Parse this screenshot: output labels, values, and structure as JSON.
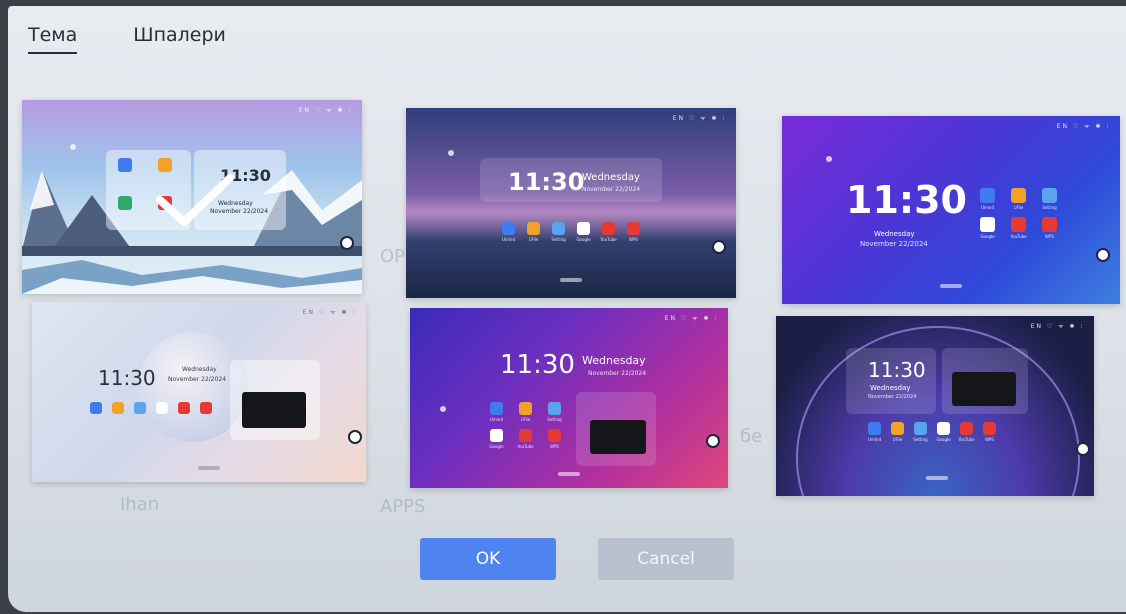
{
  "tabs": [
    {
      "label": "Тема",
      "active": true
    },
    {
      "label": "Шпалери",
      "active": false
    }
  ],
  "background_labels": [
    "OP",
    "APPS",
    "бе",
    "Ihan"
  ],
  "themes": [
    {
      "id": 1,
      "selected": true,
      "status": "EN ♡ ᯤ ✱ ⫶",
      "time": "11:30",
      "weekday": "Wednesday",
      "date": "November 22/2024"
    },
    {
      "id": 2,
      "selected": false,
      "status": "EN ♡ ᯤ ✱ ⫶",
      "time": "11:30",
      "weekday": "Wednesday",
      "date": "November 22/2024",
      "apps": [
        "Umind",
        "UFile",
        "Setting",
        "Google",
        "YouTube",
        "WPS"
      ]
    },
    {
      "id": 3,
      "selected": false,
      "status": "EN ♡ ᯤ ✱ ⫶",
      "time": "11:30",
      "weekday": "Wednesday",
      "date": "November 22/2024",
      "apps": [
        "Umind",
        "UFile",
        "Setting",
        "Google",
        "YouTube",
        "WPS"
      ]
    },
    {
      "id": 4,
      "selected": false,
      "status": "EN ♡ ᯤ ✱ ⫶",
      "time": "11:30",
      "weekday": "Wednesday",
      "date": "November 22/2024",
      "apps": [
        "Umind",
        "UFile",
        "Setting",
        "Google",
        "YouTube",
        "WPS"
      ]
    },
    {
      "id": 5,
      "selected": false,
      "status": "EN ♡ ᯤ ✱ ⫶",
      "time": "11:30",
      "weekday": "Wednesday",
      "date": "November 22/2024",
      "apps": [
        "Umind",
        "UFile",
        "Setting",
        "Google",
        "YouTube",
        "WPS"
      ]
    },
    {
      "id": 6,
      "selected": false,
      "status": "EN ♡ ᯤ ✱ ⫶",
      "time": "11:30",
      "weekday": "Wednesday",
      "date": "November 22/2024",
      "apps": [
        "Umind",
        "UFile",
        "Setting",
        "Google",
        "YouTube",
        "WPS"
      ]
    }
  ],
  "app_colors": [
    "#3f7cf0",
    "#f2a12a",
    "#5aa3ee",
    "#ffffff",
    "#e53935",
    "#e53935"
  ],
  "buttons": {
    "ok": "OK",
    "cancel": "Cancel"
  },
  "colors": {
    "accent": "#4f83f0",
    "cancel": "#b7c0cc"
  }
}
